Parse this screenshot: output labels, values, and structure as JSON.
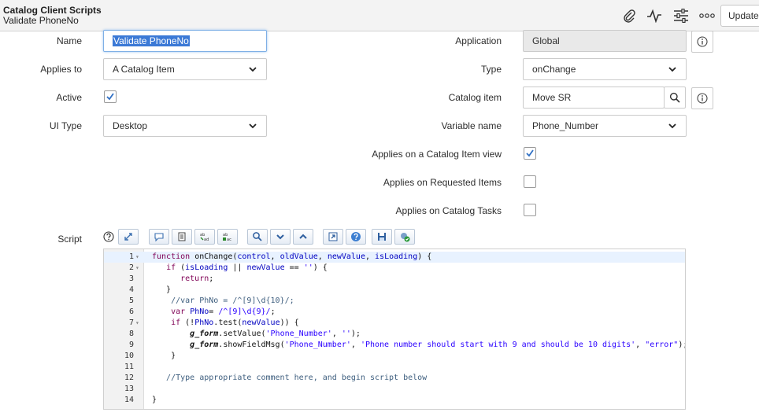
{
  "header": {
    "table_title": "Catalog Client Scripts",
    "record_title": "Validate PhoneNo",
    "update_label": "Update",
    "icons": [
      "paperclip-icon",
      "activity-icon",
      "sliders-icon",
      "more-icon"
    ]
  },
  "form": {
    "name": {
      "label": "Name",
      "value": "Validate PhoneNo"
    },
    "applies_to": {
      "label": "Applies to",
      "value": "A Catalog Item"
    },
    "active": {
      "label": "Active",
      "checked": true
    },
    "ui_type": {
      "label": "UI Type",
      "value": "Desktop"
    },
    "application": {
      "label": "Application",
      "value": "Global"
    },
    "type": {
      "label": "Type",
      "value": "onChange"
    },
    "catalog_item": {
      "label": "Catalog item",
      "value": "Move SR"
    },
    "variable_name": {
      "label": "Variable name",
      "value": "Phone_Number"
    },
    "applies_catalog_item_view": {
      "label": "Applies on a Catalog Item view",
      "checked": true
    },
    "applies_requested_items": {
      "label": "Applies on Requested Items",
      "checked": false
    },
    "applies_catalog_tasks": {
      "label": "Applies on Catalog Tasks",
      "checked": false
    },
    "script": {
      "label": "Script"
    }
  },
  "script_lines": [
    {
      "n": "1",
      "fold": true,
      "text": "function onChange(control, oldValue, newValue, isLoading) {"
    },
    {
      "n": "2",
      "fold": true,
      "text": "   if (isLoading || newValue == '') {"
    },
    {
      "n": "3",
      "fold": false,
      "text": "      return;"
    },
    {
      "n": "4",
      "fold": false,
      "text": "   }"
    },
    {
      "n": "5",
      "fold": false,
      "text": "    //var PhNo = /^[9]\\d{10}/;"
    },
    {
      "n": "6",
      "fold": false,
      "text": "    var PhNo= /^[9]\\d{9}/;"
    },
    {
      "n": "7",
      "fold": true,
      "text": "    if (!PhNo.test(newValue)) {"
    },
    {
      "n": "8",
      "fold": false,
      "text": "        g_form.setValue('Phone_Number', '');"
    },
    {
      "n": "9",
      "fold": false,
      "text": "        g_form.showFieldMsg('Phone_Number', 'Phone number should start with 9 and should be 10 digits', \"error\");"
    },
    {
      "n": "10",
      "fold": false,
      "text": "    }"
    },
    {
      "n": "11",
      "fold": false,
      "text": ""
    },
    {
      "n": "12",
      "fold": false,
      "text": "   //Type appropriate comment here, and begin script below"
    },
    {
      "n": "13",
      "fold": false,
      "text": ""
    },
    {
      "n": "14",
      "fold": false,
      "text": "}"
    }
  ],
  "colors": {
    "accent": "#3b79d6",
    "check": "#2f6fc4",
    "header_bg": "#f3f3f3"
  }
}
